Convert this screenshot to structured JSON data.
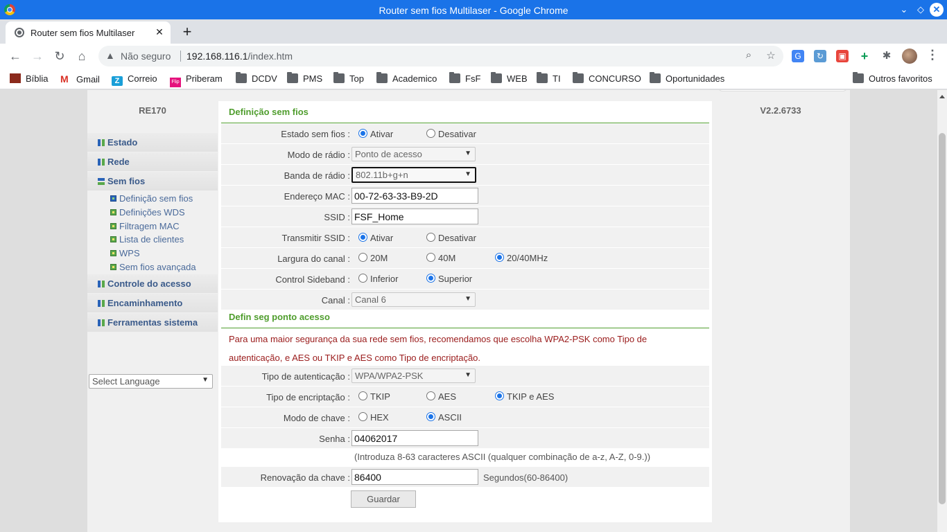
{
  "browser": {
    "window_title": "Router sem fios Multilaser - Google Chrome",
    "tab_title": "Router sem fios Multilaser",
    "security_label": "Não seguro",
    "url_host": "192.168.116.1",
    "url_path": "/index.htm",
    "bookmarks": [
      "Bíblia",
      "Gmail",
      "Correio",
      "Priberam",
      "DCDV",
      "PMS",
      "Top",
      "Academico",
      "FsF",
      "WEB",
      "TI",
      "CONCURSO",
      "Oportunidades"
    ],
    "other_bookmarks": "Outros favoritos",
    "accent": "#1a73e8"
  },
  "router": {
    "model": "RE170",
    "version": "V2.2.6733"
  },
  "sidebar": {
    "groups": {
      "estado": "Estado",
      "rede": "Rede",
      "sem_fios": "Sem fios",
      "controle": "Controle do acesso",
      "encaminhamento": "Encaminhamento",
      "ferramentas": "Ferramentas sistema"
    },
    "items": [
      "Definição sem fios",
      "Definições WDS",
      "Filtragem MAC",
      "Lista de clientes",
      "WPS",
      "Sem fios avançada"
    ],
    "language_select": "Select Language"
  },
  "wireless": {
    "section_title": "Definição sem fios",
    "estado_label": "Estado sem fios :",
    "ativar": "Ativar",
    "desativar": "Desativar",
    "modo_label": "Modo de rádio :",
    "modo_value": "Ponto de acesso",
    "banda_label": "Banda de rádio :",
    "banda_value": "802.11b+g+n",
    "mac_label": "Endereço MAC :",
    "mac_value": "00-72-63-33-B9-2D",
    "ssid_label": "SSID :",
    "ssid_value": "FSF_Home",
    "transmitir_label": "Transmitir SSID :",
    "largura_label": "Largura do canal :",
    "largura_options": [
      "20M",
      "40M",
      "20/40MHz"
    ],
    "sideband_label": "Control Sideband :",
    "sideband_options": [
      "Inferior",
      "Superior"
    ],
    "canal_label": "Canal :",
    "canal_value": "Canal 6"
  },
  "security": {
    "section_title": "Defin seg ponto acesso",
    "note_line1": "Para uma maior segurança da sua rede sem fios, recomendamos que escolha WPA2-PSK como Tipo de",
    "note_line2": "autenticação, e AES ou TKIP e AES como Tipo de encriptação.",
    "auth_label": "Tipo de autenticação :",
    "auth_value": "WPA/WPA2-PSK",
    "enc_label": "Tipo de encriptação :",
    "enc_options": [
      "TKIP",
      "AES",
      "TKIP e AES"
    ],
    "key_mode_label": "Modo de chave :",
    "key_mode_options": [
      "HEX",
      "ASCII"
    ],
    "password_label": "Senha :",
    "password_value": "04062017",
    "password_hint": "(Introduza 8-63 caracteres ASCII (qualquer combinação de a-z, A-Z, 0-9.))",
    "renew_label": "Renovação da chave :",
    "renew_value": "86400",
    "renew_unit": "Segundos(60-86400)",
    "save_button": "Guardar"
  }
}
